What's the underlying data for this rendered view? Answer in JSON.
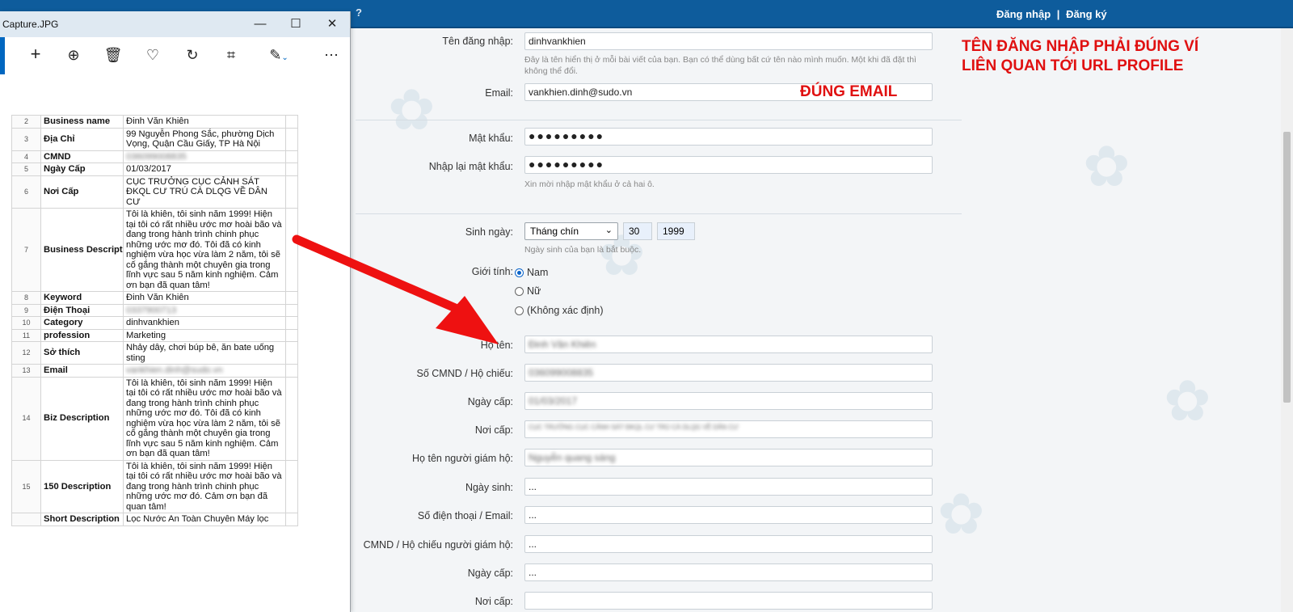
{
  "topbar": {
    "left_fragment": "?",
    "login": "Đăng nhập",
    "divider": "|",
    "register": "Đăng ký",
    "color": "#0e5c9c"
  },
  "form": {
    "username_label": "Tên đăng nhập:",
    "username_value": "dinhvankhien",
    "username_hint": "Đây là tên hiển thị ở mỗi bài viết của bạn. Bạn có thể dùng bất cứ tên nào mình muốn. Một khi đã đặt thì không thể đổi.",
    "email_label": "Email:",
    "email_value": "vankhien.dinh@sudo.vn",
    "password_label": "Mật khẩu:",
    "password_value": "●●●●●●●●●",
    "password_confirm_label": "Nhập lại mật khẩu:",
    "password_confirm_value": "●●●●●●●●●",
    "password_hint": "Xin mời nhập mật khẩu ở cả hai ô.",
    "birthday_label": "Sinh ngày:",
    "birth_month": "Tháng chín",
    "birth_day": "30",
    "birth_year": "1999",
    "birthday_hint": "Ngày sinh của bạn là bắt buộc.",
    "gender_label": "Giới tính:",
    "gender_options": [
      "Nam",
      "Nữ",
      "(Không xác định)"
    ],
    "fullname_label": "Họ tên:",
    "fullname_value": "Đinh Văn Khiên",
    "id_label": "Số CMND / Hộ chiếu:",
    "id_value": "036099008835",
    "issue_date_label": "Ngày cấp:",
    "issue_date_value": "01/03/2017",
    "issue_place_label": "Nơi cấp:",
    "issue_place_value": "CỤC TRƯỞNG CỤC CẢNH SÁT ĐKQL CƯ TRÚ CÀ DLQG VỀ DÂN CƯ",
    "guardian_name_label": "Họ tên người giám hộ:",
    "guardian_name_value": "Nguyễn quang sáng",
    "guardian_birth_label": "Ngày sinh:",
    "guardian_birth_value": "...",
    "guardian_contact_label": "Số điện thoại / Email:",
    "guardian_contact_value": "...",
    "guardian_id_label": "CMND / Hộ chiếu người giám hộ:",
    "guardian_id_value": "...",
    "guardian_issue_date_label": "Ngày cấp:",
    "guardian_issue_date_value": "...",
    "guardian_issue_place_label": "Nơi cấp:"
  },
  "annotations": {
    "username_note_line1": "TÊN ĐĂNG NHẬP PHẢI ĐÚNG VÍ",
    "username_note_line2": "LIÊN QUAN TỚI URL PROFILE",
    "email_note": "ĐÚNG EMAIL",
    "color": "#e01010"
  },
  "viewer": {
    "title": "Capture.JPG",
    "toolbar_icons": [
      "add-icon",
      "zoom-in-icon",
      "delete-icon",
      "favorite-icon",
      "rotate-icon",
      "crop-icon",
      "edit-icon",
      "more-icon"
    ],
    "rows": [
      {
        "n": "2",
        "k": "Business name",
        "v": "Đinh Văn Khiên"
      },
      {
        "n": "3",
        "k": "Địa Chỉ",
        "v": "99 Nguyễn Phong Sắc, phường Dịch Vọng, Quận Cầu Giấy, TP Hà Nội"
      },
      {
        "n": "4",
        "k": "CMND",
        "v": "036099008835"
      },
      {
        "n": "5",
        "k": "Ngày Cấp",
        "v": "01/03/2017"
      },
      {
        "n": "6",
        "k": "Nơi Cấp",
        "v": "CỤC TRƯỞNG CỤC CẢNH SÁT ĐKQL CƯ TRÚ CÀ DLQG VỀ DÂN CƯ"
      },
      {
        "n": "7",
        "k": "Business Descripti",
        "v": "Tôi là khiên, tôi sinh năm 1999! Hiện tại tôi có rất nhiều ước mơ hoài bão và đang trong hành trình chinh phục những ước mơ đó. Tôi đã có kinh nghiệm vừa học vừa làm 2 năm, tôi sẽ cố gắng thành một chuyên gia trong lĩnh vực sau 5 năm kinh nghiệm. Cảm ơn bạn đã quan tâm!"
      },
      {
        "n": "8",
        "k": "Keyword",
        "v": "Đinh Văn Khiên"
      },
      {
        "n": "9",
        "k": "Điện Thoại",
        "v": "0337900713"
      },
      {
        "n": "10",
        "k": "Category",
        "v": "dinhvankhien"
      },
      {
        "n": "11",
        "k": "profession",
        "v": "Marketing"
      },
      {
        "n": "12",
        "k": "Sở thích",
        "v": "Nhảy dây, chơi búp bê, ăn bate uống sting"
      },
      {
        "n": "13",
        "k": "Email",
        "v": "vankhien.dinh@sudo.vn"
      },
      {
        "n": "14",
        "k": "Biz Description",
        "v": "Tôi là khiên, tôi sinh năm 1999! Hiện tại tôi có rất nhiều ước mơ hoài bão và đang trong hành trình chinh phục những ước mơ đó. Tôi đã có kinh nghiệm vừa học vừa làm 2 năm, tôi sẽ cố gắng thành một chuyên gia trong lĩnh vực sau 5 năm kinh nghiệm. Cảm ơn bạn đã quan tâm!"
      },
      {
        "n": "15",
        "k": "150 Description",
        "v": "Tôi là khiên, tôi sinh năm 1999! Hiện tại tôi có rất nhiều ước mơ hoài bão và đang trong hành trình chinh phục những ước mơ đó. Cảm ơn bạn đã quan tâm!"
      },
      {
        "n": "",
        "k": "Short Description",
        "v": "Lọc Nước An Toàn Chuyên Máy lọc"
      }
    ]
  }
}
